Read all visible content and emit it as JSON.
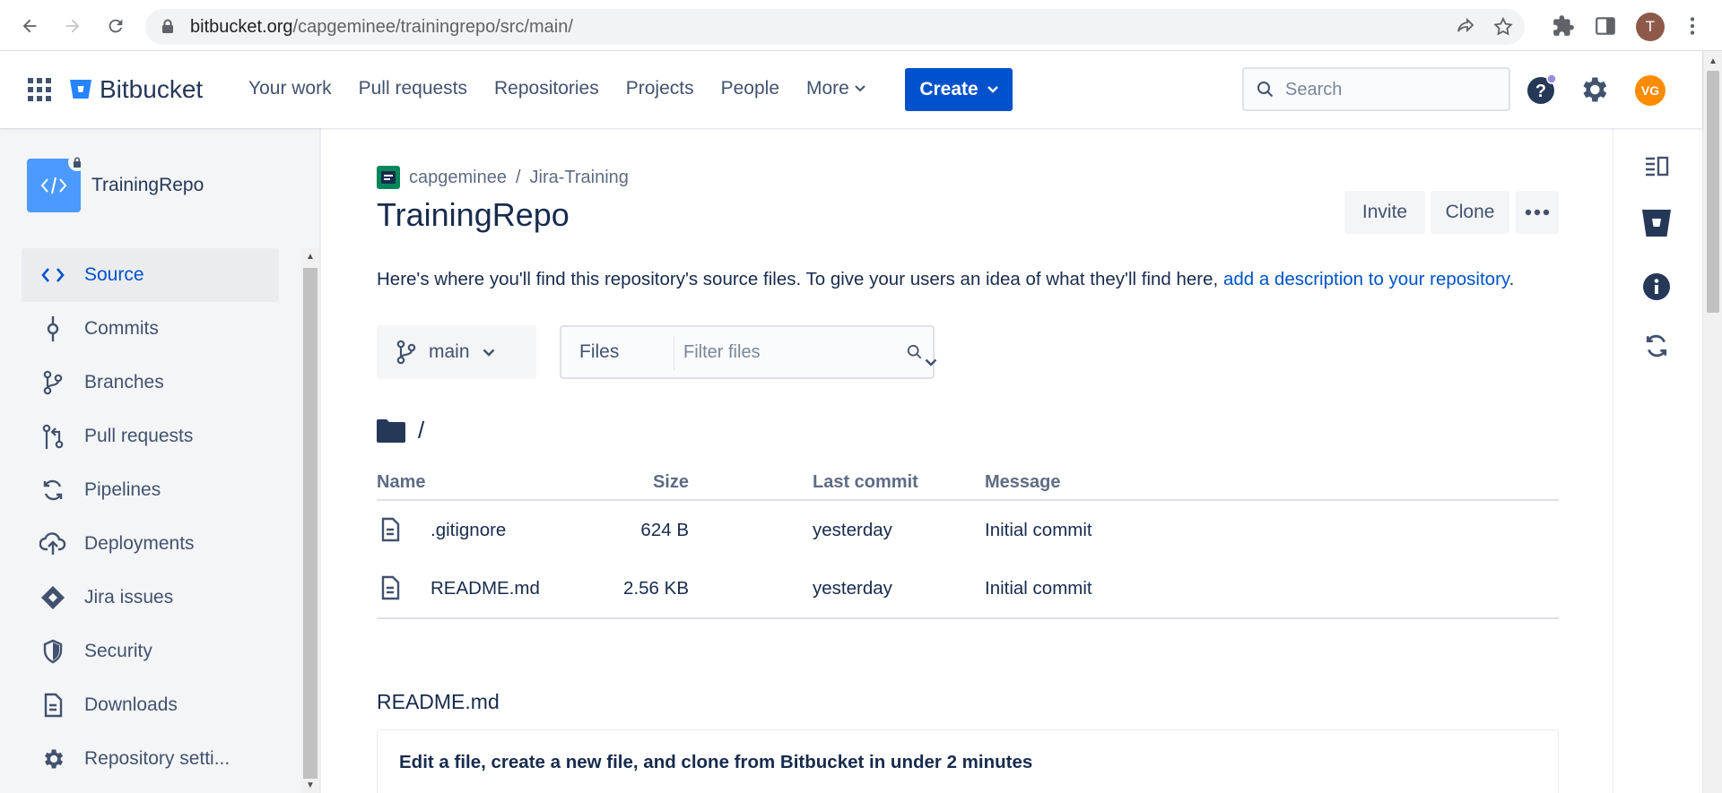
{
  "browser": {
    "url_host": "bitbucket.org",
    "url_path": "/capgeminee/trainingrepo/src/main/",
    "profile_initial": "T"
  },
  "header": {
    "product": "Bitbucket",
    "nav": [
      "Your work",
      "Pull requests",
      "Repositories",
      "Projects",
      "People",
      "More"
    ],
    "create_label": "Create",
    "search_placeholder": "Search",
    "avatar_initials": "VG"
  },
  "sidebar": {
    "repo_name": "TrainingRepo",
    "items": [
      {
        "label": "Source",
        "icon": "code-icon",
        "active": true
      },
      {
        "label": "Commits",
        "icon": "commit-icon"
      },
      {
        "label": "Branches",
        "icon": "branch-icon"
      },
      {
        "label": "Pull requests",
        "icon": "pull-request-icon"
      },
      {
        "label": "Pipelines",
        "icon": "pipelines-icon"
      },
      {
        "label": "Deployments",
        "icon": "cloud-upload-icon"
      },
      {
        "label": "Jira issues",
        "icon": "jira-icon"
      },
      {
        "label": "Security",
        "icon": "shield-icon"
      },
      {
        "label": "Downloads",
        "icon": "document-icon"
      },
      {
        "label": "Repository setti...",
        "icon": "gear-icon"
      }
    ]
  },
  "main": {
    "breadcrumb": {
      "workspace": "capgeminee",
      "separator": "/",
      "project": "Jira-Training"
    },
    "title": "TrainingRepo",
    "actions": {
      "invite": "Invite",
      "clone": "Clone",
      "more": "•••"
    },
    "description_text": "Here's where you'll find this repository's source files. To give your users an idea of what they'll find here, ",
    "description_link": "add a description to your repository",
    "description_end": ".",
    "branch": "main",
    "filter_type": "Files",
    "filter_placeholder": "Filter files",
    "path": "/",
    "table": {
      "headers": {
        "name": "Name",
        "size": "Size",
        "last_commit": "Last commit",
        "message": "Message"
      },
      "rows": [
        {
          "name": ".gitignore",
          "size": "624 B",
          "last_commit": "yesterday",
          "message": "Initial commit"
        },
        {
          "name": "README.md",
          "size": "2.56 KB",
          "last_commit": "yesterday",
          "message": "Initial commit"
        }
      ]
    },
    "readme_title": "README.md",
    "readme_heading": "Edit a file, create a new file, and clone from Bitbucket in under 2 minutes"
  },
  "colors": {
    "brand": "#0052cc",
    "link": "#0052cc",
    "avatar": "#ff8b00",
    "sidebar_bg": "#f4f5f7"
  }
}
